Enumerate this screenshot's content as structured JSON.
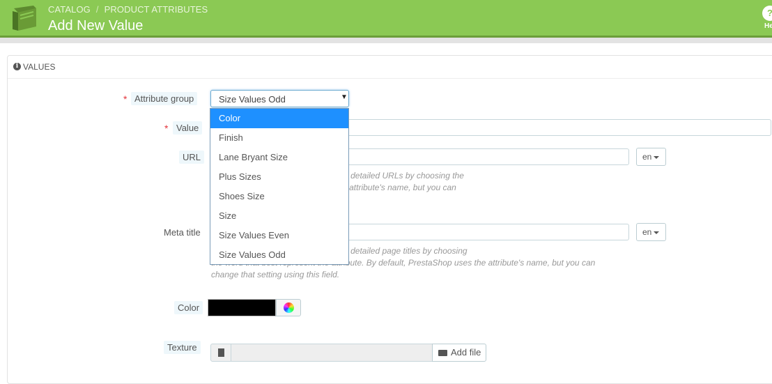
{
  "header": {
    "breadcrumb": [
      "CATALOG",
      "PRODUCT ATTRIBUTES"
    ],
    "breadcrumb_sep": "/",
    "title": "Add New Value",
    "help_label": "He",
    "bg_color": "#8bc954"
  },
  "panel": {
    "heading": "VALUES",
    "heading_icon": "info-icon"
  },
  "form": {
    "attribute_group": {
      "label": "Attribute group",
      "required": "*",
      "selected": "Size Values Odd",
      "options": [
        "Color",
        "Finish",
        "Lane Bryant Size",
        "Plus Sizes",
        "Shoes Size",
        "Size",
        "Size Values Even",
        "Size Values Odd"
      ],
      "highlighted": "Color"
    },
    "value": {
      "label": "Value",
      "required": "*",
      "value": ""
    },
    "url": {
      "label": "URL",
      "value": "",
      "lang": "en",
      "help": [
        " module is enabled, you can get more detailed URLs by choosing the",
        "ute. By default, PrestaShop uses the attribute's name, but you can"
      ]
    },
    "meta_title": {
      "label": "Meta title",
      "value": "",
      "lang": "en",
      "help": [
        " module is enabled, you can get more detailed page titles by choosing",
        "the word that best represent the attribute. By default, PrestaShop uses the attribute's name, but you can",
        "change that setting using this field."
      ]
    },
    "color": {
      "label": "Color",
      "value": "#000000"
    },
    "texture": {
      "label": "Texture",
      "button": "Add file"
    }
  }
}
